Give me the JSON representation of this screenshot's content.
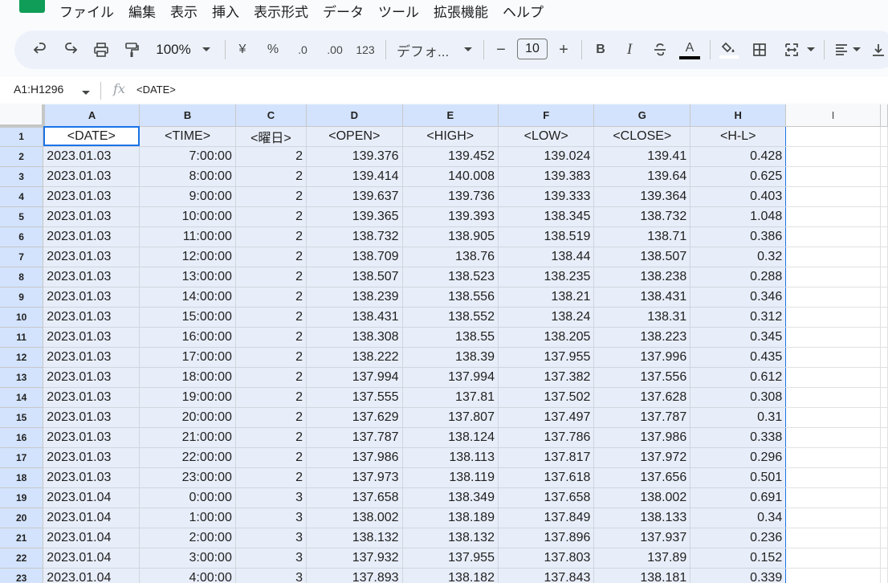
{
  "menu": {
    "items": [
      "ファイル",
      "編集",
      "表示",
      "挿入",
      "表示形式",
      "データ",
      "ツール",
      "拡張機能",
      "ヘルプ"
    ]
  },
  "toolbar": {
    "zoom": "100%",
    "currency_label": "¥",
    "percent_label": "%",
    "decrease_decimal_label": ".0",
    "increase_decimal_label": ".00",
    "format_123_label": "123",
    "font_name": "デフォ...",
    "minus_label": "−",
    "font_size": "10",
    "plus_label": "+",
    "bold_label": "B",
    "italic_label": "I",
    "text_color_label": "A"
  },
  "formula_bar": {
    "name_box": "A1:H1296",
    "fx_label": "fx",
    "formula": "<DATE>"
  },
  "sheet": {
    "columns": [
      "A",
      "B",
      "C",
      "D",
      "E",
      "F",
      "G",
      "H",
      "I"
    ],
    "header_row": [
      "<DATE>",
      "<TIME>",
      "<曜日>",
      "<OPEN>",
      "<HIGH>",
      "<LOW>",
      "<CLOSE>",
      "<H-L>"
    ],
    "rows": [
      [
        "2023.01.03",
        "7:00:00",
        "2",
        "139.376",
        "139.452",
        "139.024",
        "139.41",
        "0.428"
      ],
      [
        "2023.01.03",
        "8:00:00",
        "2",
        "139.414",
        "140.008",
        "139.383",
        "139.64",
        "0.625"
      ],
      [
        "2023.01.03",
        "9:00:00",
        "2",
        "139.637",
        "139.736",
        "139.333",
        "139.364",
        "0.403"
      ],
      [
        "2023.01.03",
        "10:00:00",
        "2",
        "139.365",
        "139.393",
        "138.345",
        "138.732",
        "1.048"
      ],
      [
        "2023.01.03",
        "11:00:00",
        "2",
        "138.732",
        "138.905",
        "138.519",
        "138.71",
        "0.386"
      ],
      [
        "2023.01.03",
        "12:00:00",
        "2",
        "138.709",
        "138.76",
        "138.44",
        "138.507",
        "0.32"
      ],
      [
        "2023.01.03",
        "13:00:00",
        "2",
        "138.507",
        "138.523",
        "138.235",
        "138.238",
        "0.288"
      ],
      [
        "2023.01.03",
        "14:00:00",
        "2",
        "138.239",
        "138.556",
        "138.21",
        "138.431",
        "0.346"
      ],
      [
        "2023.01.03",
        "15:00:00",
        "2",
        "138.431",
        "138.552",
        "138.24",
        "138.31",
        "0.312"
      ],
      [
        "2023.01.03",
        "16:00:00",
        "2",
        "138.308",
        "138.55",
        "138.205",
        "138.223",
        "0.345"
      ],
      [
        "2023.01.03",
        "17:00:00",
        "2",
        "138.222",
        "138.39",
        "137.955",
        "137.996",
        "0.435"
      ],
      [
        "2023.01.03",
        "18:00:00",
        "2",
        "137.994",
        "137.994",
        "137.382",
        "137.556",
        "0.612"
      ],
      [
        "2023.01.03",
        "19:00:00",
        "2",
        "137.555",
        "137.81",
        "137.502",
        "137.628",
        "0.308"
      ],
      [
        "2023.01.03",
        "20:00:00",
        "2",
        "137.629",
        "137.807",
        "137.497",
        "137.787",
        "0.31"
      ],
      [
        "2023.01.03",
        "21:00:00",
        "2",
        "137.787",
        "138.124",
        "137.786",
        "137.986",
        "0.338"
      ],
      [
        "2023.01.03",
        "22:00:00",
        "2",
        "137.986",
        "138.113",
        "137.817",
        "137.972",
        "0.296"
      ],
      [
        "2023.01.03",
        "23:00:00",
        "2",
        "137.973",
        "138.119",
        "137.618",
        "137.656",
        "0.501"
      ],
      [
        "2023.01.04",
        "0:00:00",
        "3",
        "137.658",
        "138.349",
        "137.658",
        "138.002",
        "0.691"
      ],
      [
        "2023.01.04",
        "1:00:00",
        "3",
        "138.002",
        "138.189",
        "137.849",
        "138.133",
        "0.34"
      ],
      [
        "2023.01.04",
        "2:00:00",
        "3",
        "138.132",
        "138.132",
        "137.896",
        "137.937",
        "0.236"
      ],
      [
        "2023.01.04",
        "3:00:00",
        "3",
        "137.932",
        "137.955",
        "137.803",
        "137.89",
        "0.152"
      ],
      [
        "2023.01.04",
        "4:00:00",
        "3",
        "137.893",
        "138.182",
        "137.843",
        "138.181",
        "0.339"
      ]
    ]
  }
}
